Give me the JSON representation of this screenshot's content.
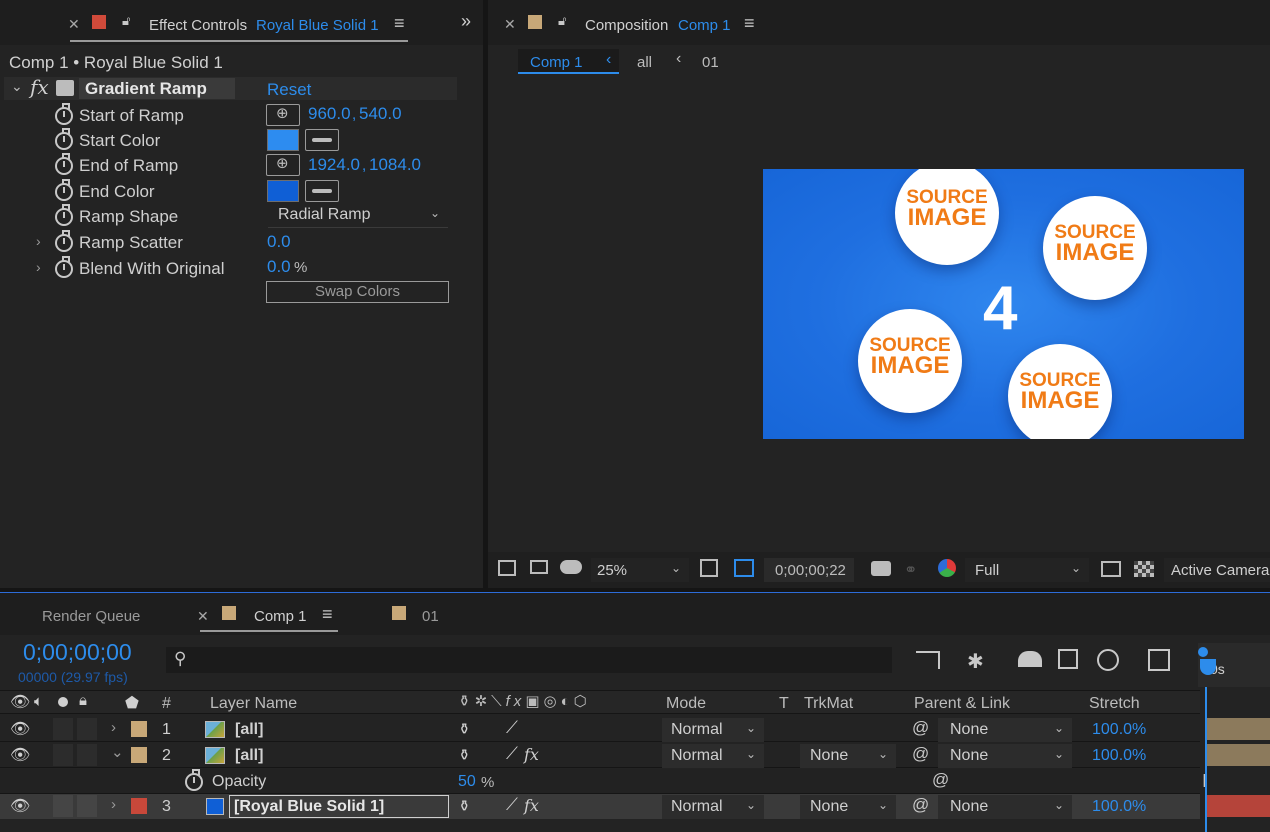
{
  "effect_controls": {
    "tab_title": "Effect Controls",
    "tab_target": "Royal Blue Solid 1",
    "breadcrumb": "Comp 1 • Royal Blue Solid 1",
    "effect_name": "Gradient Ramp",
    "reset_label": "Reset",
    "fx_label": "fx",
    "props": {
      "start_of_ramp": {
        "label": "Start of Ramp",
        "x": "960.0",
        "y": "540.0"
      },
      "start_color": {
        "label": "Start Color",
        "color": "#2d8cf0"
      },
      "end_of_ramp": {
        "label": "End of Ramp",
        "x": "1924.0",
        "y": "1084.0"
      },
      "end_color": {
        "label": "End Color",
        "color": "#0f5fd6"
      },
      "ramp_shape": {
        "label": "Ramp Shape",
        "value": "Radial Ramp"
      },
      "ramp_scatter": {
        "label": "Ramp Scatter",
        "value": "0.0"
      },
      "blend_with_original": {
        "label": "Blend With Original",
        "value": "0.0",
        "unit": "%"
      }
    },
    "swap_colors_label": "Swap Colors"
  },
  "composition": {
    "tab_title": "Composition",
    "tab_target": "Comp 1",
    "nav": {
      "current": "Comp 1",
      "item2": "all",
      "item3": "01"
    },
    "preview": {
      "center_number": "4",
      "circles": [
        {
          "line1": "SOURCE",
          "line2": "IMAGE"
        },
        {
          "line1": "SOURCE",
          "line2": "IMAGE"
        },
        {
          "line1": "SOURCE",
          "line2": "IMAGE"
        },
        {
          "line1": "SOURCE",
          "line2": "IMAGE"
        }
      ]
    },
    "footer": {
      "zoom": "25%",
      "timecode": "0;00;00;22",
      "resolution": "Full",
      "camera": "Active Camera"
    }
  },
  "timeline": {
    "tabs": {
      "render_queue": "Render Queue",
      "comp1": "Comp 1",
      "t01": "01"
    },
    "current_time": "0;00;00;00",
    "frame_info": "00000 (29.97 fps)",
    "ruler_label": "0s",
    "headers": {
      "num": "#",
      "layer_name": "Layer Name",
      "mode": "Mode",
      "t": "T",
      "trkmat": "TrkMat",
      "parent": "Parent & Link",
      "stretch": "Stretch"
    },
    "layers": [
      {
        "num": "1",
        "name": "[all]",
        "mode": "Normal",
        "trkmat": "",
        "parent": "None",
        "stretch": "100.0%",
        "color": "#c8a878"
      },
      {
        "num": "2",
        "name": "[all]",
        "mode": "Normal",
        "trkmat": "None",
        "parent": "None",
        "stretch": "100.0%",
        "color": "#c8a878"
      },
      {
        "num": "3",
        "name": "[Royal Blue Solid 1]",
        "mode": "Normal",
        "trkmat": "None",
        "parent": "None",
        "stretch": "100.0%",
        "color": "#c8483a"
      }
    ],
    "opacity": {
      "label": "Opacity",
      "value": "50",
      "unit": "%"
    }
  },
  "colors": {
    "accent_blue": "#2d8ceb",
    "comp_bg_blue": "#1f6fe0",
    "source_orange": "#f07b16",
    "ec_tab_swatch": "#d04a3a",
    "comp_tab_swatch": "#c8a878"
  }
}
